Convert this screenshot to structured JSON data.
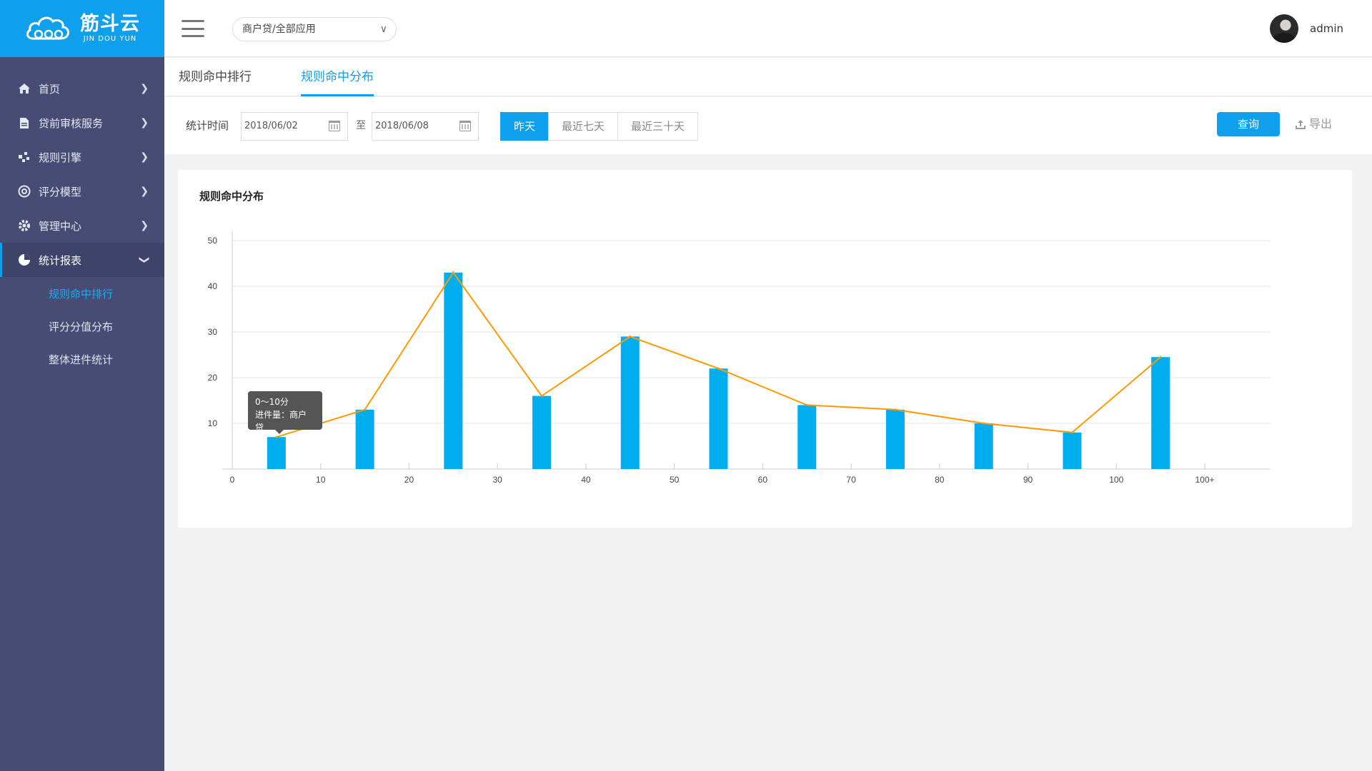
{
  "brand": {
    "name_cn": "筋斗云",
    "name_en": "JIN DOU YUN"
  },
  "header": {
    "app_select": "商户贷/全部应用",
    "username": "admin"
  },
  "sidebar": {
    "items": [
      {
        "label": "首页",
        "icon": "home-icon"
      },
      {
        "label": "贷前审核服务",
        "icon": "document-icon"
      },
      {
        "label": "规则引擎",
        "icon": "nodes-icon"
      },
      {
        "label": "评分模型",
        "icon": "target-icon"
      },
      {
        "label": "管理中心",
        "icon": "gear-icon"
      },
      {
        "label": "统计报表",
        "icon": "pie-chart-icon",
        "expanded": true
      }
    ],
    "sub_items": [
      {
        "label": "规则命中排行",
        "current": true
      },
      {
        "label": "评分分值分布"
      },
      {
        "label": "整体进件统计"
      }
    ]
  },
  "tabs": [
    {
      "label": "规则命中排行"
    },
    {
      "label": "规则命中分布",
      "active": true
    }
  ],
  "filter": {
    "label": "统计时间",
    "start_date": "2018/06/02",
    "to": "至",
    "end_date": "2018/06/08",
    "quick": [
      "昨天",
      "最近七天",
      "最近三十天"
    ],
    "quick_selected": "昨天",
    "query": "查询",
    "export": "导出"
  },
  "card": {
    "title": "规则命中分布"
  },
  "tooltip": {
    "title": "0～10分",
    "label": "进件量：",
    "value": "商户贷"
  },
  "colors": {
    "accent": "#0ea0ec",
    "bar": "#00aeef",
    "line": "#ff9900",
    "sidebar": "#464c74"
  },
  "chart_data": {
    "type": "bar",
    "categories": [
      "0-10",
      "10-20",
      "20-30",
      "30-40",
      "40-50",
      "50-60",
      "60-70",
      "70-80",
      "80-90",
      "90-100",
      "100+"
    ],
    "series": [
      {
        "type": "bar",
        "values": [
          7,
          13,
          43,
          16,
          29,
          22,
          14,
          13,
          10,
          8,
          24.5
        ]
      },
      {
        "type": "line",
        "values": [
          7,
          13,
          43,
          16,
          29,
          22,
          14,
          13,
          10,
          8,
          24.5
        ]
      }
    ],
    "x_ticks": [
      "0",
      "10",
      "20",
      "30",
      "40",
      "50",
      "60",
      "70",
      "80",
      "90",
      "100",
      "100+"
    ],
    "y_ticks": [
      10,
      20,
      30,
      40,
      50
    ],
    "ylim": [
      0,
      50
    ],
    "grid": true
  }
}
